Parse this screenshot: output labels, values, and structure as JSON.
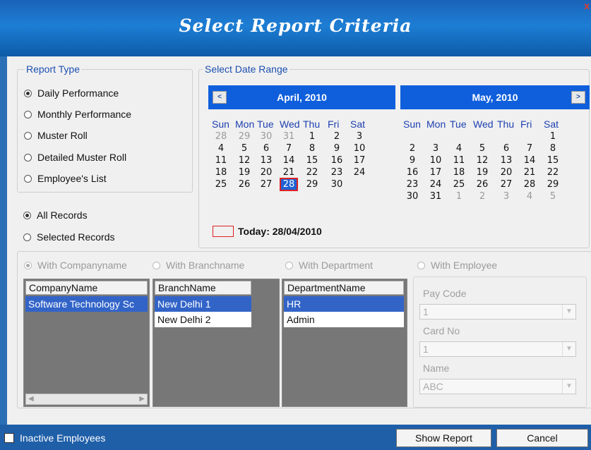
{
  "window": {
    "title": "Select Report Criteria",
    "close_glyph": "x"
  },
  "report_type": {
    "legend": "Report Type",
    "options": [
      "Daily Performance",
      "Monthly Performance",
      "Muster Roll",
      "Detailed Muster Roll",
      "Employee's List"
    ],
    "selected": 0
  },
  "records": {
    "options": [
      "All Records",
      "Selected Records"
    ],
    "selected": 0
  },
  "date_range": {
    "legend": "Select Date Range",
    "weekdays": [
      "Sun",
      "Mon",
      "Tue",
      "Wed",
      "Thu",
      "Fri",
      "Sat"
    ],
    "april": {
      "title": "April, 2010",
      "weeks": [
        [
          "28",
          "29",
          "30",
          "31",
          "1",
          "2",
          "3"
        ],
        [
          "4",
          "5",
          "6",
          "7",
          "8",
          "9",
          "10"
        ],
        [
          "11",
          "12",
          "13",
          "14",
          "15",
          "16",
          "17"
        ],
        [
          "18",
          "19",
          "20",
          "21",
          "22",
          "23",
          "24"
        ],
        [
          "25",
          "26",
          "27",
          "28",
          "29",
          "30",
          ""
        ]
      ]
    },
    "may": {
      "title": "May, 2010",
      "weeks": [
        [
          "",
          "",
          "",
          "",
          "",
          "",
          "1"
        ],
        [
          "2",
          "3",
          "4",
          "5",
          "6",
          "7",
          "8"
        ],
        [
          "9",
          "10",
          "11",
          "12",
          "13",
          "14",
          "15"
        ],
        [
          "16",
          "17",
          "18",
          "19",
          "20",
          "21",
          "22"
        ],
        [
          "23",
          "24",
          "25",
          "26",
          "27",
          "28",
          "29"
        ],
        [
          "30",
          "31",
          "1",
          "2",
          "3",
          "4",
          "5"
        ]
      ]
    },
    "today_label": "Today: 28/04/2010",
    "prev_glyph": "<",
    "next_glyph": ">"
  },
  "filters": {
    "options": [
      "With Companyname",
      "With Branchname",
      "With Department",
      "With Employee"
    ],
    "selected": 0
  },
  "company_grid": {
    "header": "CompanyName",
    "rows": [
      "Software Technology Sc"
    ]
  },
  "branch_grid": {
    "header": "BranchName",
    "rows": [
      "New Delhi 1",
      "New Delhi 2"
    ]
  },
  "department_grid": {
    "header": "DepartmentName",
    "rows": [
      "HR",
      "Admin"
    ]
  },
  "employee": {
    "pay_code_label": "Pay Code",
    "pay_code_value": "1",
    "card_no_label": "Card No",
    "card_no_value": "1",
    "name_label": "Name",
    "name_value": "ABC"
  },
  "footer": {
    "inactive_label": "Inactive Employees",
    "show_report": "Show Report",
    "cancel": "Cancel"
  },
  "colors": {
    "accent": "#0f5fdc",
    "selection": "#3264c8",
    "today_marker": "#e02020"
  }
}
